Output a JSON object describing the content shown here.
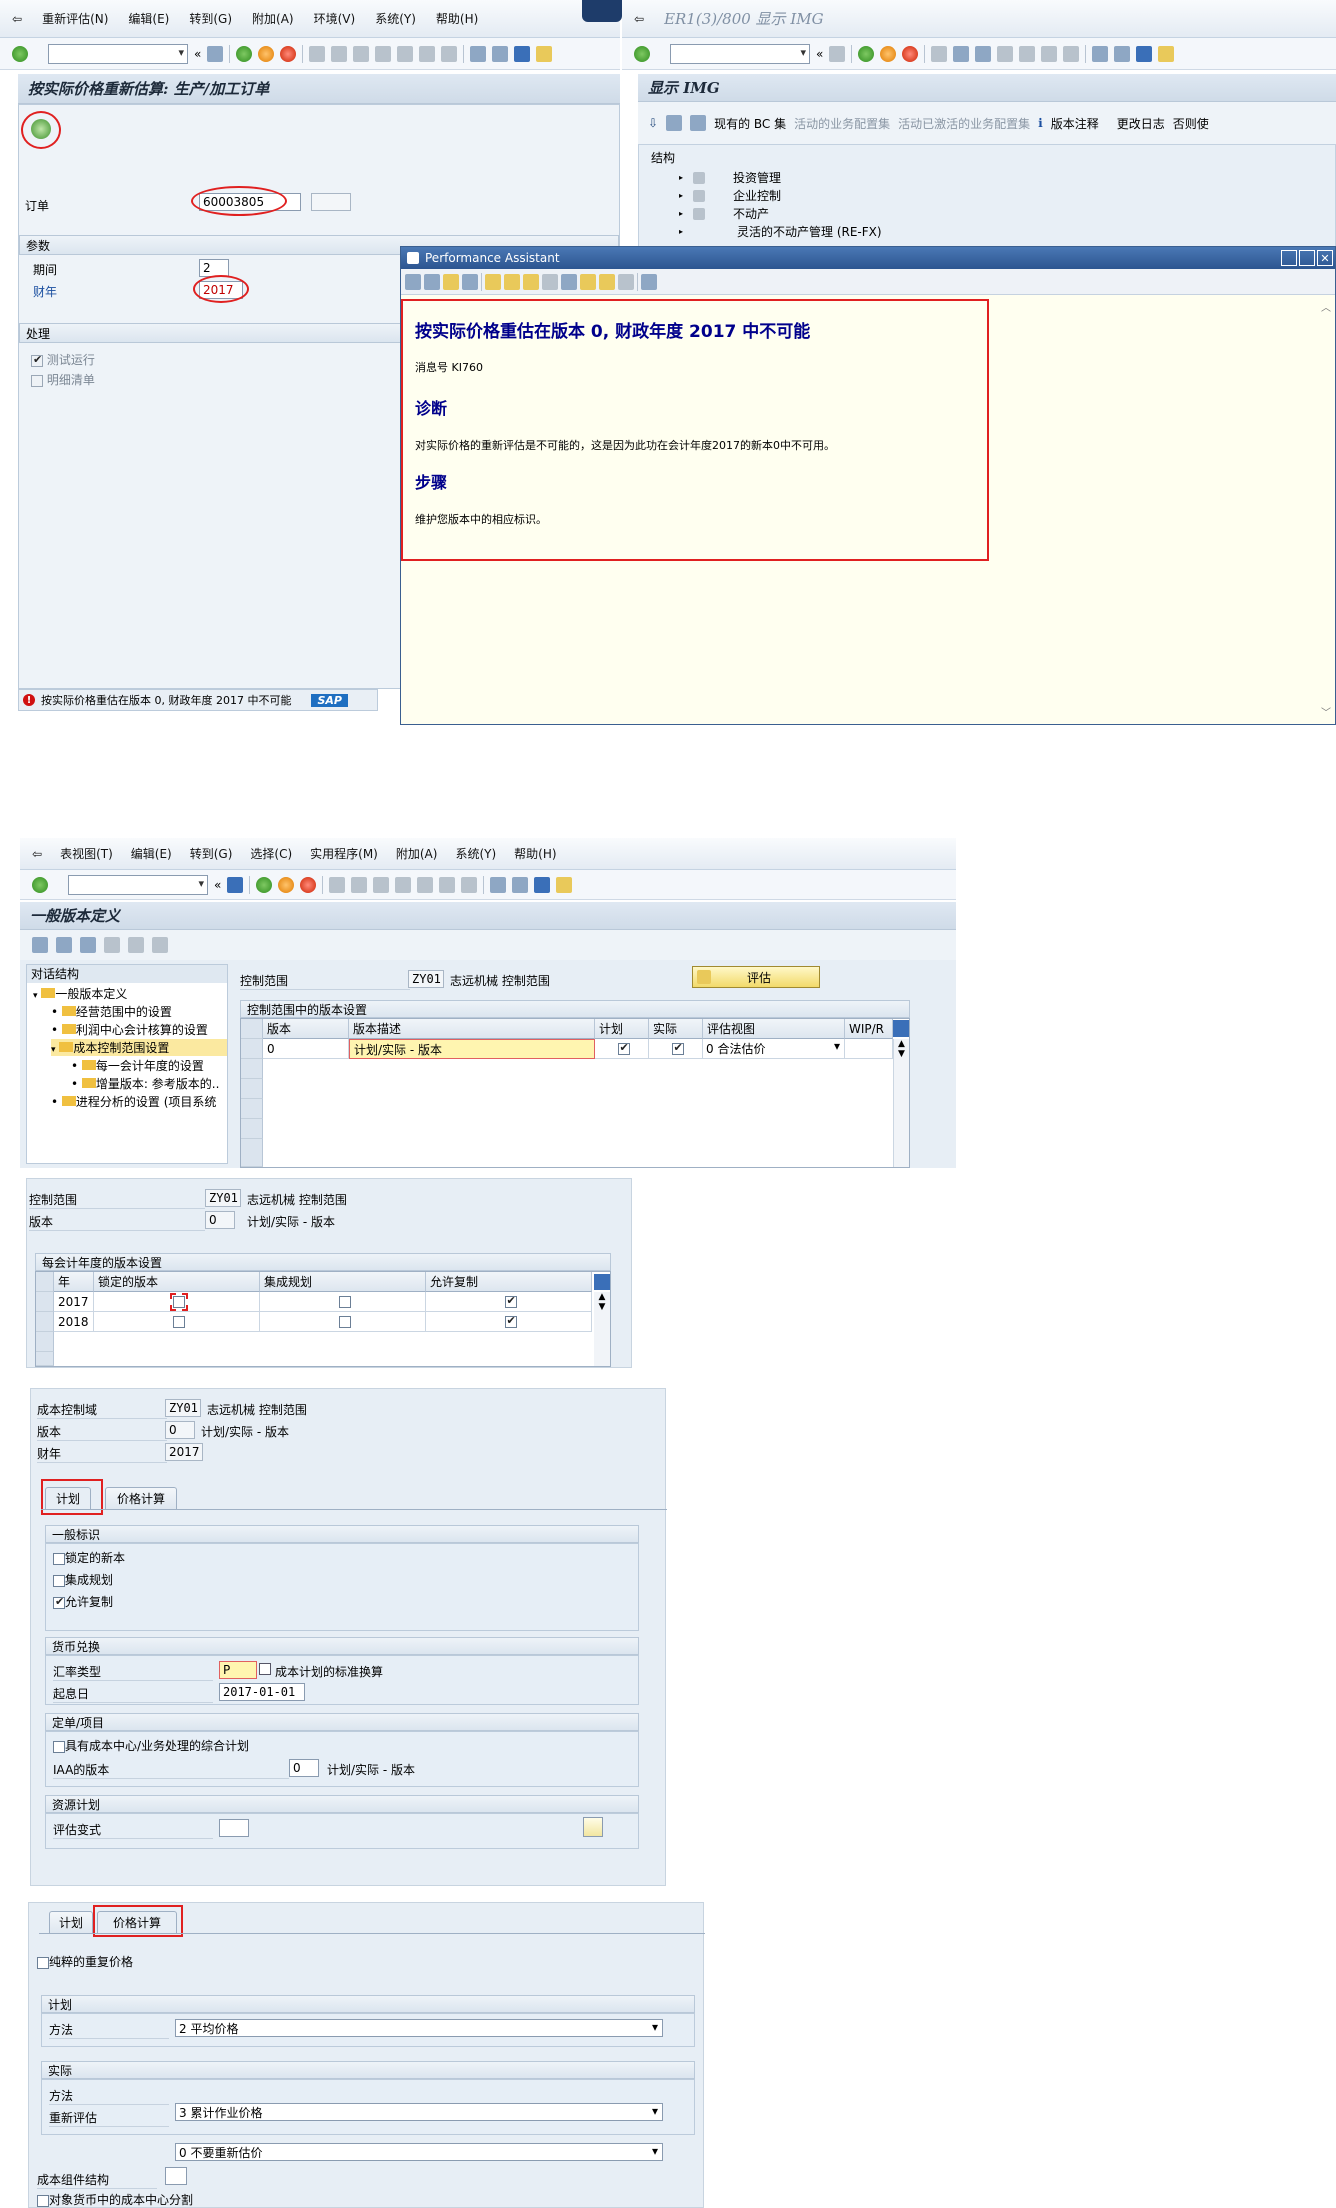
{
  "s1": {
    "menu": [
      "重新评估(N)",
      "编辑(E)",
      "转到(G)",
      "附加(A)",
      "环境(V)",
      "系统(Y)",
      "帮助(H)"
    ],
    "title": "按实际价格重新估算: 生产/加工订单",
    "order_label": "订单",
    "order_value": "60003805",
    "params_header": "参数",
    "period_label": "期间",
    "period_value": "2",
    "year_label": "财年",
    "year_value": "2017",
    "process_header": "处理",
    "test_run": "测试运行",
    "detail_list": "明细清单",
    "status_message": "按实际价格重估在版本 0, 财政年度 2017 中不可能",
    "sap_logo": "SAP"
  },
  "img": {
    "window_title": "ER1(3)/800 显示 IMG",
    "title": "显示 IMG",
    "toolbar": [
      "现有的 BC 集",
      "活动的业务配置集",
      "活动已激活的业务配置集",
      "版本注释",
      "更改日志",
      "否则使"
    ],
    "structure_label": "结构",
    "tree": [
      "投资管理",
      "企业控制",
      "不动产",
      "灵活的不动产管理 (RE-FX)"
    ]
  },
  "pa": {
    "title": "Performance Assistant",
    "heading": "按实际价格重估在版本  0, 财政年度  2017 中不可能",
    "msgno": "消息号  KI760",
    "diag_title": "诊断",
    "diag_text": "对实际价格的重新评估是不可能的，这是因为此功在会计年度2017的新本0中不可用。",
    "steps_title": "步骤",
    "steps_text": "维护您版本中的相应标识。"
  },
  "s2": {
    "menu": [
      "表视图(T)",
      "编辑(E)",
      "转到(G)",
      "选择(C)",
      "实用程序(M)",
      "附加(A)",
      "系统(Y)",
      "帮助(H)"
    ],
    "title": "一般版本定义",
    "dialog_structure": "对话结构",
    "tree": [
      "一般版本定义",
      "经营范围中的设置",
      "利润中心会计核算的设置",
      "成本控制范围设置",
      "每一会计年度的设置",
      "增量版本: 参考版本的..",
      "进程分析的设置 (项目系统"
    ],
    "ca_label": "控制范围",
    "ca_value": "ZY01",
    "ca_name": "志远机械 控制范围",
    "eval_button": "评估",
    "table_title": "控制范围中的版本设置",
    "headers": [
      "版本",
      "版本描述",
      "计划",
      "实际",
      "评估视图",
      "WIP/R"
    ],
    "row": {
      "version": "0",
      "desc": "计划/实际 - 版本",
      "view": "0 合法估价"
    }
  },
  "s3": {
    "ca_label": "控制范围",
    "ca_value": "ZY01",
    "ca_name": "志远机械 控制范围",
    "ver_label": "版本",
    "ver_value": "0",
    "ver_name": "计划/实际 - 版本",
    "table_title": "每会计年度的版本设置",
    "headers": [
      "年",
      "锁定的版本",
      "集成规划",
      "允许复制"
    ],
    "years": [
      "2017",
      "2018"
    ]
  },
  "s4": {
    "ca_label": "成本控制域",
    "ca_value": "ZY01",
    "ca_name": "志远机械 控制范围",
    "ver_label": "版本",
    "ver_value": "0",
    "ver_name": "计划/实际 - 版本",
    "year_label": "财年",
    "year_value": "2017",
    "tab_plan": "计划",
    "tab_price": "价格计算",
    "general_header": "一般标识",
    "locked": "锁定的新本",
    "integrated": "集成规划",
    "copy": "允许复制",
    "fx_header": "货币兑换",
    "rate_label": "汇率类型",
    "rate_value": "P",
    "rate_desc": "成本计划的标准换算",
    "date_label": "起息日",
    "date_value": "2017-01-01",
    "order_header": "定单/项目",
    "cc_plan": "具有成本中心/业务处理的综合计划",
    "iaa_label": "IAA的版本",
    "iaa_value": "0",
    "iaa_name": "计划/实际 - 版本",
    "res_header": "资源计划",
    "formula_label": "评估变式"
  },
  "s5": {
    "tab_plan": "计划",
    "tab_price": "价格计算",
    "pure_revalue": "纯粹的重复价格",
    "plan_header": "计划",
    "method_label": "方法",
    "plan_method": "2 平均价格",
    "actual_header": "实际",
    "actual_method": "3 累计作业价格",
    "reval_label": "重新评估",
    "reval_value": "0 不要重新估价",
    "comp_label": "成本组件结构",
    "split_label": "对象货币中的成本中心分割"
  }
}
